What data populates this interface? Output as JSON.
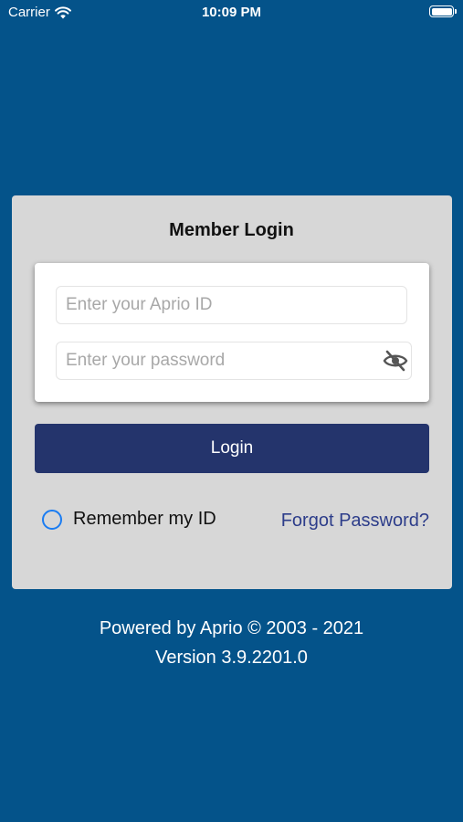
{
  "status_bar": {
    "carrier": "Carrier",
    "time": "10:09 PM",
    "wifi_icon": "wifi-icon",
    "battery_icon": "battery-full-icon",
    "battery_level": 1.0
  },
  "login": {
    "title": "Member Login",
    "id_placeholder": "Enter your Aprio ID",
    "id_value": "",
    "password_placeholder": "Enter your password",
    "password_value": "",
    "password_toggle_icon": "eye-slash-icon",
    "login_button_label": "Login",
    "remember_label": "Remember my ID",
    "remember_checked": false,
    "forgot_label": "Forgot Password?"
  },
  "footer": {
    "powered_by": "Powered by Aprio © 2003 - 2021",
    "version": "Version 3.9.2201.0"
  },
  "colors": {
    "background": "#04538a",
    "card": "#d7d7d7",
    "button": "#24346c",
    "radio": "#1a7cf2",
    "link": "#2d3d8a"
  }
}
